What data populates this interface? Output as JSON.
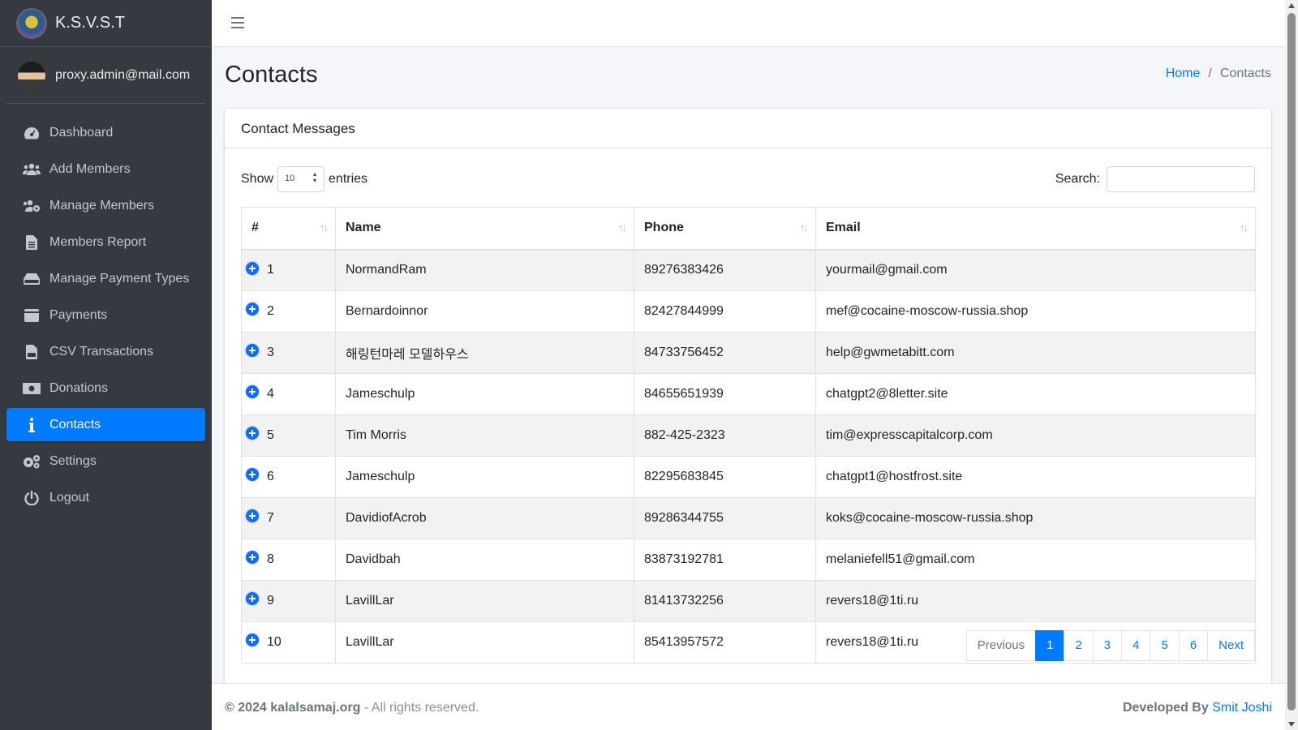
{
  "brand": {
    "name": "K.S.V.S.T"
  },
  "user": {
    "email": "proxy.admin@mail.com"
  },
  "sidebar": {
    "items": [
      {
        "label": "Dashboard",
        "icon": "tachometer-icon"
      },
      {
        "label": "Add Members",
        "icon": "users-icon"
      },
      {
        "label": "Manage Members",
        "icon": "users-cog-icon"
      },
      {
        "label": "Members Report",
        "icon": "file-icon"
      },
      {
        "label": "Manage Payment Types",
        "icon": "hdd-icon"
      },
      {
        "label": "Payments",
        "icon": "wallet-icon"
      },
      {
        "label": "CSV Transactions",
        "icon": "file-csv-icon"
      },
      {
        "label": "Donations",
        "icon": "money-bill-icon"
      },
      {
        "label": "Contacts",
        "icon": "info-icon",
        "active": true
      },
      {
        "label": "Settings",
        "icon": "cogs-icon"
      },
      {
        "label": "Logout",
        "icon": "power-icon"
      }
    ]
  },
  "header": {
    "title": "Contacts",
    "breadcrumb": {
      "home": "Home",
      "current": "Contacts"
    }
  },
  "card": {
    "title": "Contact Messages",
    "length": {
      "show_label": "Show",
      "value": "10",
      "entries_label": "entries"
    },
    "search": {
      "label": "Search:",
      "value": ""
    },
    "columns": [
      "#",
      "Name",
      "Phone",
      "Email"
    ],
    "rows": [
      {
        "id": "1",
        "name": "NormandRam",
        "phone": "89276383426",
        "email": "yourmail@gmail.com"
      },
      {
        "id": "2",
        "name": "Bernardoinnor",
        "phone": "82427844999",
        "email": "mef@cocaine-moscow-russia.shop"
      },
      {
        "id": "3",
        "name": "해링턴마레 모델하우스",
        "phone": "84733756452",
        "email": "help@gwmetabitt.com"
      },
      {
        "id": "4",
        "name": "Jameschulp",
        "phone": "84655651939",
        "email": "chatgpt2@8letter.site"
      },
      {
        "id": "5",
        "name": "Tim Morris",
        "phone": "882-425-2323",
        "email": "tim@expresscapitalcorp.com"
      },
      {
        "id": "6",
        "name": "Jameschulp",
        "phone": "82295683845",
        "email": "chatgpt1@hostfrost.site"
      },
      {
        "id": "7",
        "name": "DavidiofAcrob",
        "phone": "89286344755",
        "email": "koks@cocaine-moscow-russia.shop"
      },
      {
        "id": "8",
        "name": "Davidbah",
        "phone": "83873192781",
        "email": "melaniefell51@gmail.com"
      },
      {
        "id": "9",
        "name": "LavillLar",
        "phone": "81413732256",
        "email": "revers18@1ti.ru"
      },
      {
        "id": "10",
        "name": "LavillLar",
        "phone": "85413957572",
        "email": "revers18@1ti.ru"
      }
    ],
    "pagination": [
      "Previous",
      "1",
      "2",
      "3",
      "4",
      "5",
      "6",
      "Next"
    ],
    "active_page": "1"
  },
  "footer": {
    "copyright": "© 2024 kalalsamaj.org",
    "rights": " - All rights reserved.",
    "developed_label": "Developed By ",
    "developer": "Smit Joshi"
  },
  "colors": {
    "sidebar_bg": "#343a40",
    "accent": "#007bff",
    "page_bg": "#f4f6f9"
  }
}
